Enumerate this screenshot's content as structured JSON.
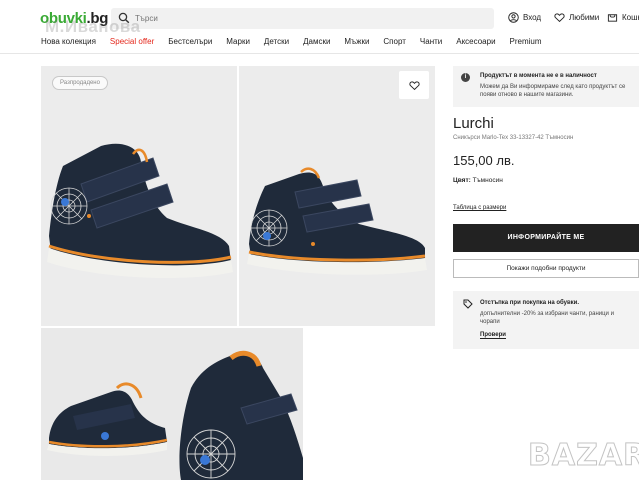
{
  "header": {
    "logo_main": "obuvki",
    "logo_dot": ".bg",
    "search_placeholder": "Търси",
    "login": "Вход",
    "favorites": "Любими",
    "cart": "Кошн"
  },
  "nav": {
    "items": [
      {
        "label": "Нова колекция"
      },
      {
        "label": "Special offer"
      },
      {
        "label": "Бестселъри"
      },
      {
        "label": "Марки"
      },
      {
        "label": "Детски"
      },
      {
        "label": "Дамски"
      },
      {
        "label": "Мъжки"
      },
      {
        "label": "Спорт"
      },
      {
        "label": "Чанти"
      },
      {
        "label": "Аксесоари"
      },
      {
        "label": "Premium"
      }
    ]
  },
  "watermark": "М.Иванова",
  "gallery": {
    "tag": "Разпродадено"
  },
  "notice": {
    "title": "Продуктът в момента не е в наличност",
    "text": "Можем да Ви информираме след като продуктът се появи отново в нашите магазини."
  },
  "product": {
    "brand": "Lurchi",
    "subtitle": "Сникърси Marlo-Tex 33-13327-42 Тъмносин",
    "price": "155,00 лв.",
    "color_label": "Цвят:",
    "color_value": "Тъмносин",
    "size_table": "Таблица с размери",
    "notify_button": "ИНФОРМИРАЙТЕ МЕ",
    "similar_button": "Покажи подобни продукти"
  },
  "promo": {
    "title": "Отстъпка при покупка на обувки.",
    "text": "допълнителни -20% за избрани чанти, раници и чорапи",
    "link": "Провери"
  },
  "bazar_watermark": "BAZAR",
  "colors": {
    "brand_green": "#3aaa35",
    "special_red": "#e4271b",
    "shoe_navy": "#1f2a3a",
    "shoe_orange": "#e88a2a"
  }
}
